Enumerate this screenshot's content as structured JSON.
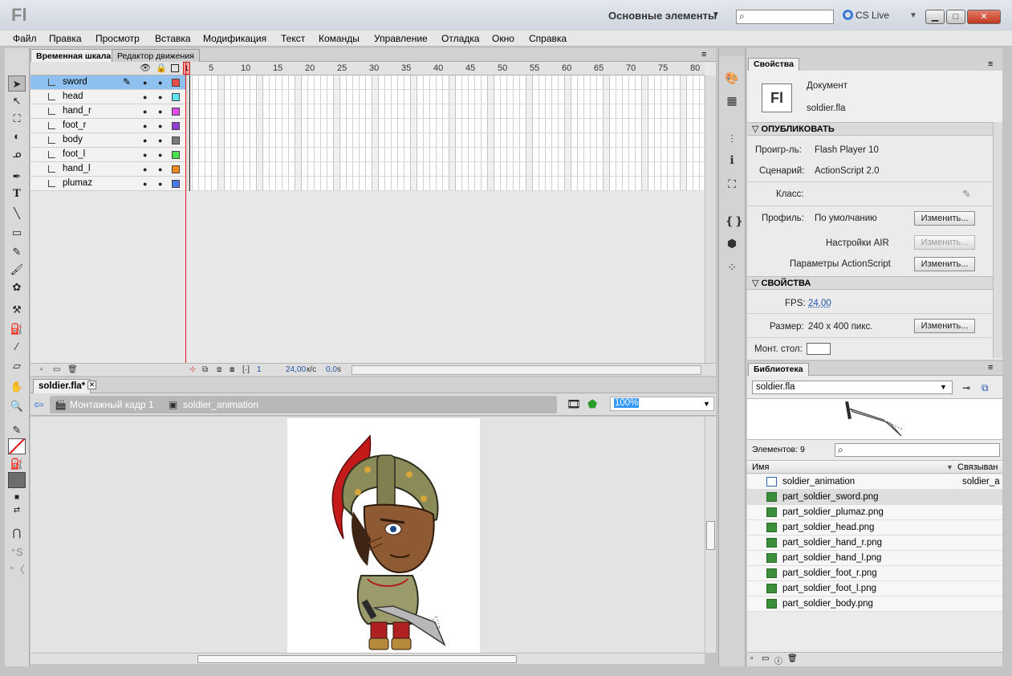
{
  "titlebar": {
    "logo": "Fl",
    "workspace": "Основные элементы",
    "search_placeholder": "",
    "cslive": "CS Live",
    "btn_min": "▁",
    "btn_max": "□",
    "btn_close": "✕"
  },
  "menu": [
    "Файл",
    "Правка",
    "Просмотр",
    "Вставка",
    "Модификация",
    "Текст",
    "Команды",
    "Управление",
    "Отладка",
    "Окно",
    "Справка"
  ],
  "timeline": {
    "tabs": [
      "Временная шкала",
      "Редактор движения"
    ],
    "playhead_frame": "1",
    "frame_numbers": [
      "5",
      "10",
      "15",
      "20",
      "25",
      "30",
      "35",
      "40",
      "45",
      "50",
      "55",
      "60",
      "65",
      "70",
      "75",
      "80"
    ],
    "layers": [
      {
        "name": "sword",
        "color": "#e94a4a"
      },
      {
        "name": "head",
        "color": "#5de3f2"
      },
      {
        "name": "hand_r",
        "color": "#e24ae8"
      },
      {
        "name": "foot_r",
        "color": "#8f3fd6"
      },
      {
        "name": "body",
        "color": "#7a7a7a"
      },
      {
        "name": "foot_l",
        "color": "#4ae04a"
      },
      {
        "name": "hand_l",
        "color": "#f28a1d"
      },
      {
        "name": "plumaz",
        "color": "#4a7ae8"
      }
    ],
    "current_frame": "1",
    "fps_value": "24,00",
    "fps_unit": "к/с",
    "time": "0,0",
    "time_unit": "s"
  },
  "document": {
    "tab": "soldier.fla*",
    "close": "✕",
    "crumb_scene": "Монтажный кадр 1",
    "crumb_symbol": "soldier_animation",
    "zoom": "100%"
  },
  "properties": {
    "tab": "Свойства",
    "doc_icon": "Fl",
    "doc_type": "Документ",
    "doc_name": "soldier.fla",
    "section_publish": "ОПУБЛИКОВАТЬ",
    "player_label": "Проигр-ль:",
    "player_value": "Flash Player 10",
    "script_label": "Сценарий:",
    "script_value": "ActionScript 2.0",
    "class_label": "Класс:",
    "profile_label": "Профиль:",
    "profile_value": "По умолчанию",
    "edit_btn": "Изменить...",
    "air_label": "Настройки AIR",
    "as_label": "Параметры ActionScript",
    "section_props": "СВОЙСТВА",
    "fps_label": "FPS:",
    "fps_value": "24,00",
    "size_label": "Размер:",
    "size_value": "240 x 400 пикс.",
    "stage_label": "Монт. стол:",
    "stage_color": "#ffffff"
  },
  "library": {
    "tab": "Библиотека",
    "selected_file": "soldier.fla",
    "items_count": "Элементов: 9",
    "col_name": "Имя",
    "col_linkage": "Связыван",
    "items": [
      {
        "name": "soldier_animation",
        "link": "soldier_a",
        "type": "movieclip"
      },
      {
        "name": "part_soldier_sword.png",
        "link": "",
        "type": "bitmap"
      },
      {
        "name": "part_soldier_plumaz.png",
        "link": "",
        "type": "bitmap"
      },
      {
        "name": "part_soldier_head.png",
        "link": "",
        "type": "bitmap"
      },
      {
        "name": "part_soldier_hand_r.png",
        "link": "",
        "type": "bitmap"
      },
      {
        "name": "part_soldier_hand_l.png",
        "link": "",
        "type": "bitmap"
      },
      {
        "name": "part_soldier_foot_r.png",
        "link": "",
        "type": "bitmap"
      },
      {
        "name": "part_soldier_foot_l.png",
        "link": "",
        "type": "bitmap"
      },
      {
        "name": "part_soldier_body.png",
        "link": "",
        "type": "bitmap"
      }
    ]
  },
  "tools": [
    "selection-tool",
    "subselection-tool",
    "free-transform-tool",
    "3d-rotation-tool",
    "lasso-tool",
    "pen-tool",
    "text-tool",
    "line-tool",
    "rectangle-tool",
    "pencil-tool",
    "brush-tool",
    "deco-tool",
    "bone-tool",
    "paint-bucket-tool",
    "eyedropper-tool",
    "eraser-tool",
    "hand-tool",
    "zoom-tool"
  ]
}
